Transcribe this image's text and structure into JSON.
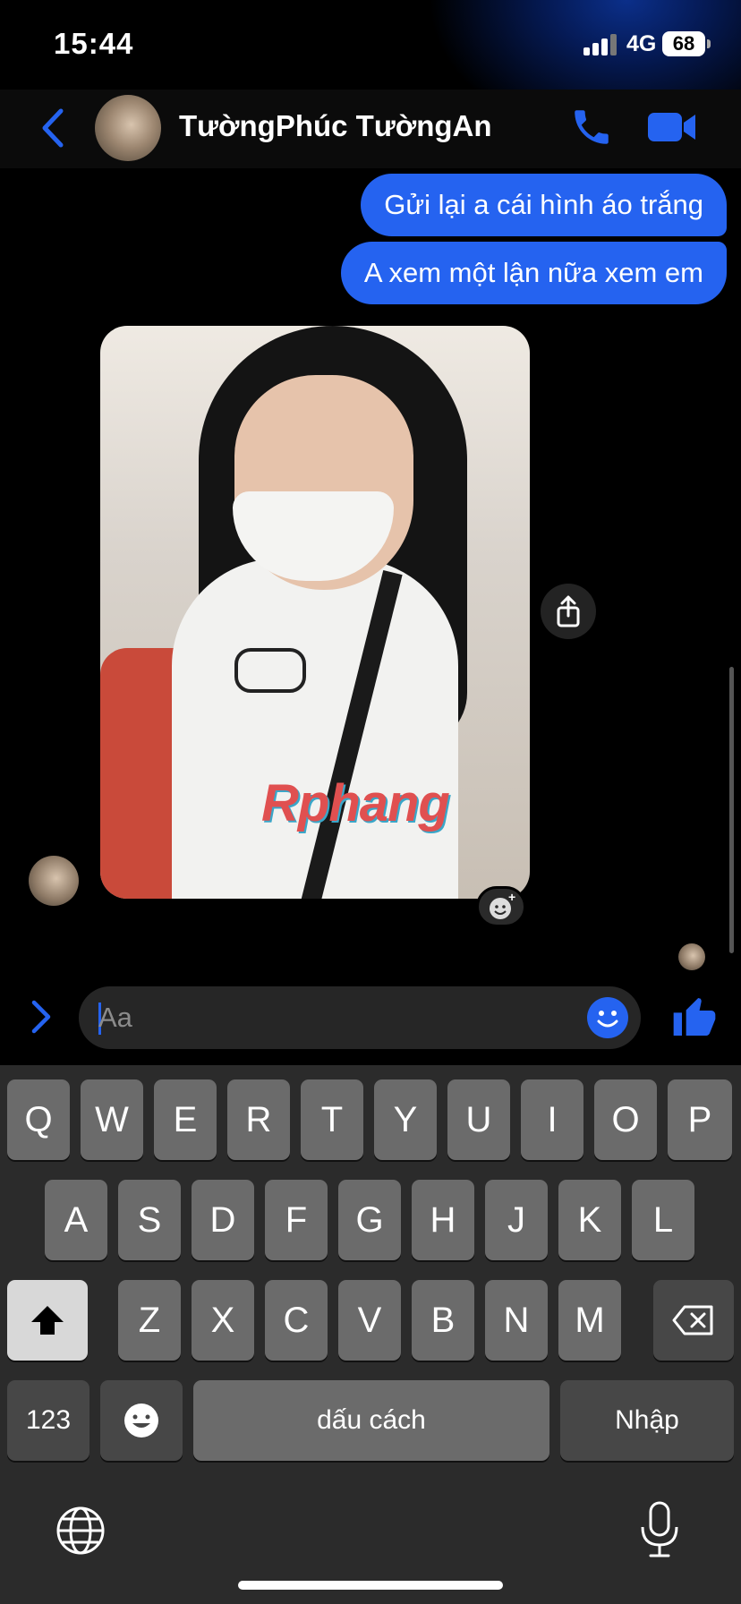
{
  "status_bar": {
    "time": "15:44",
    "network": "4G",
    "battery": "68"
  },
  "header": {
    "contact_name": "TườngPhúc TườngAn"
  },
  "messages": [
    {
      "text": "Gửi lại a cái hình áo trắng"
    },
    {
      "text": "A xem một lận nữa xem em"
    }
  ],
  "photo": {
    "watermark": "Rphang"
  },
  "composer": {
    "placeholder": "Aa"
  },
  "keyboard": {
    "row1": [
      "Q",
      "W",
      "E",
      "R",
      "T",
      "Y",
      "U",
      "I",
      "O",
      "P"
    ],
    "row2": [
      "A",
      "S",
      "D",
      "F",
      "G",
      "H",
      "J",
      "K",
      "L"
    ],
    "row3": [
      "Z",
      "X",
      "C",
      "V",
      "B",
      "N",
      "M"
    ],
    "numbers_label": "123",
    "space_label": "dấu cách",
    "return_label": "Nhập"
  },
  "colors": {
    "accent": "#2563f0",
    "background": "#000000",
    "keyboard": "#2b2b2b"
  },
  "icons": [
    "back-chevron-icon",
    "phone-icon",
    "video-camera-icon",
    "share-icon",
    "add-reaction-icon",
    "expand-chevron-icon",
    "emoji-icon",
    "thumbs-up-icon",
    "shift-icon",
    "backspace-icon",
    "globe-icon",
    "microphone-icon"
  ]
}
